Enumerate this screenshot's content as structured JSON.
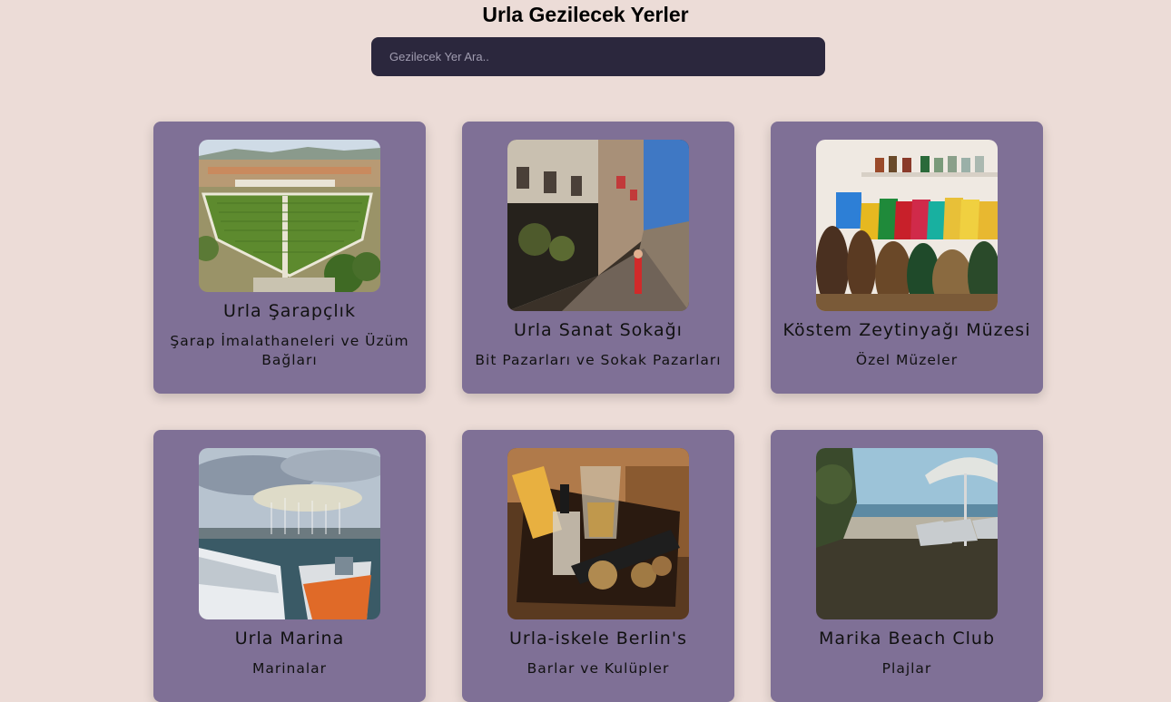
{
  "header": {
    "title": "Urla Gezilecek Yerler"
  },
  "search": {
    "placeholder": "Gezilecek Yer Ara.."
  },
  "cards": [
    {
      "name": "Urla Şarapçlık",
      "category": "Şarap İmalathaneleri ve Üzüm Bağları",
      "image": "vineyard-photo"
    },
    {
      "name": "Urla Sanat Sokağı",
      "category": "Bit Pazarları ve Sokak Pazarları",
      "image": "street-photo"
    },
    {
      "name": "Köstem Zeytinyağı Müzesi",
      "category": "Özel Müzeler",
      "image": "museum-bottles-photo"
    },
    {
      "name": "Urla Marina",
      "category": "Marinalar",
      "image": "marina-photo"
    },
    {
      "name": "Urla-iskele Berlin's",
      "category": "Barlar ve Kulüpler",
      "image": "bar-drinks-photo"
    },
    {
      "name": "Marika Beach Club",
      "category": "Plajlar",
      "image": "beach-photo"
    }
  ]
}
